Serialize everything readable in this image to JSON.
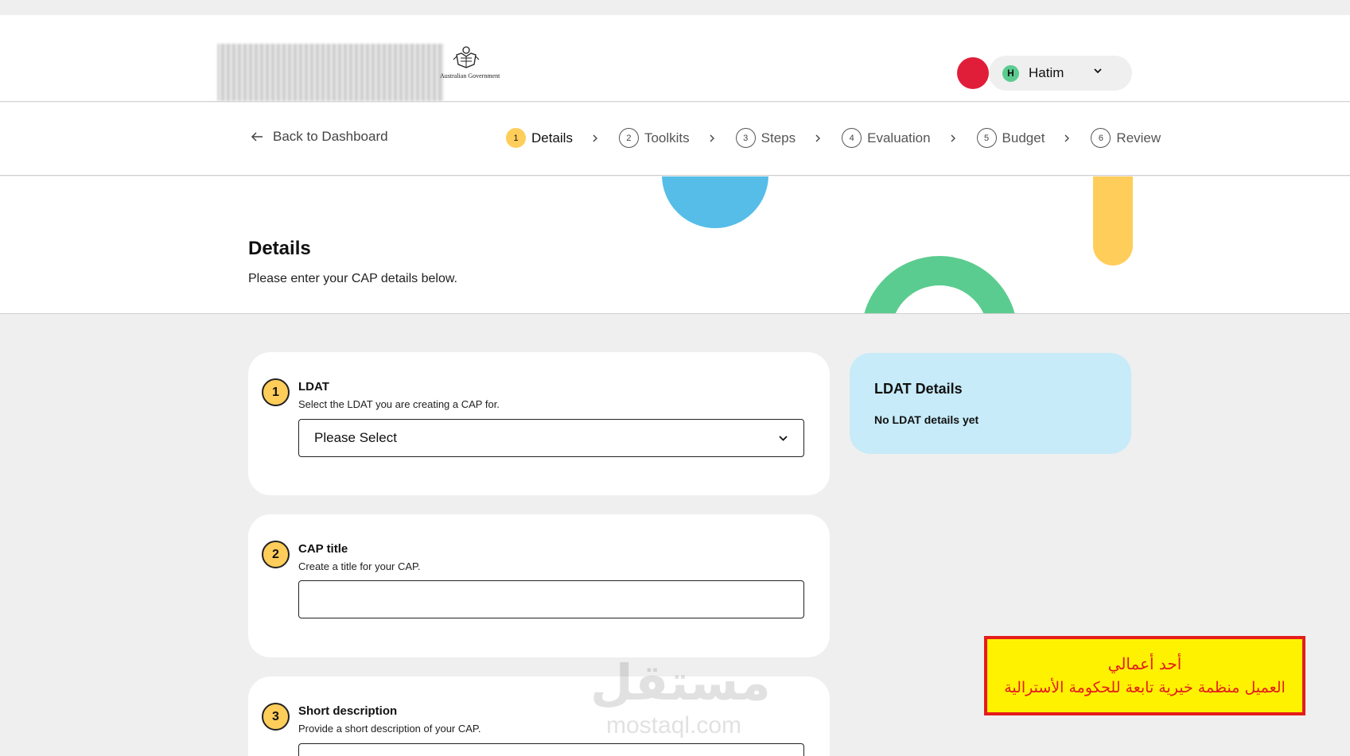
{
  "header": {
    "logo_alt": "Australian Government",
    "user": {
      "initial": "H",
      "name": "Hatim"
    }
  },
  "nav": {
    "back_label": "Back to Dashboard",
    "steps": [
      {
        "num": "1",
        "label": "Details",
        "active": true
      },
      {
        "num": "2",
        "label": "Toolkits",
        "active": false
      },
      {
        "num": "3",
        "label": "Steps",
        "active": false
      },
      {
        "num": "4",
        "label": "Evaluation",
        "active": false
      },
      {
        "num": "5",
        "label": "Budget",
        "active": false
      },
      {
        "num": "6",
        "label": "Review",
        "active": false
      }
    ]
  },
  "hero": {
    "title": "Details",
    "subtitle": "Please enter your CAP details below."
  },
  "cards": [
    {
      "num": "1",
      "title": "LDAT",
      "desc": "Select the LDAT you are creating a CAP for.",
      "select_value": "Please Select"
    },
    {
      "num": "2",
      "title": "CAP title",
      "desc": "Create a title for your CAP.",
      "value": ""
    },
    {
      "num": "3",
      "title": "Short description",
      "desc": "Provide a short description of your CAP.",
      "value": ""
    }
  ],
  "side_panel": {
    "title": "LDAT Details",
    "text": "No LDAT details yet"
  },
  "watermark": {
    "arabic": "مستقل",
    "latin": "mostaql.com"
  },
  "note": {
    "line1": "أحد أعمالي",
    "line2": "العميل منظمة خيرية تابعة للحكومة الأسترالية"
  },
  "colors": {
    "accent_yellow": "#ffcd5a",
    "accent_blue": "#56bde8",
    "accent_green": "#5bcc8f",
    "accent_red": "#e11e3a",
    "panel_blue": "#c7ebf8"
  }
}
